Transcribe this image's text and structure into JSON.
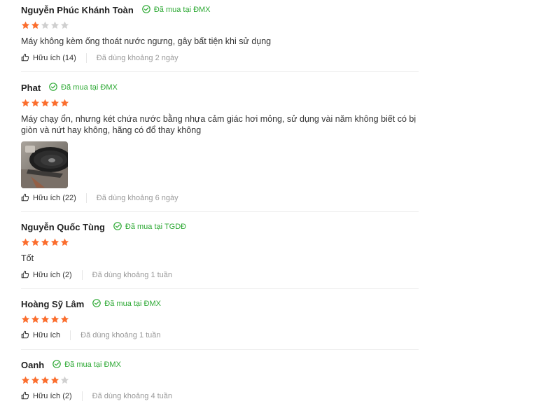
{
  "reviews": [
    {
      "name": "Nguyễn Phúc Khánh Toàn",
      "badge": "Đã mua tại ĐMX",
      "rating": 2,
      "comment": "Máy không kèm ống thoát nước ngưng, gây bất tiện khi sử dụng",
      "helpful": "Hữu ích (14)",
      "used": "Đã dùng khoảng 2 ngày"
    },
    {
      "name": "Phat",
      "badge": "Đã mua tại ĐMX",
      "rating": 5,
      "comment": "Máy chạy ổn, nhưng két chứa nước bằng nhựa cảm giác hơi mỏng, sử dụng vài năm không biết có bị giòn và nứt hay không, hãng có đổ thay không",
      "has_photo": true,
      "helpful": "Hữu ích (22)",
      "used": "Đã dùng khoảng 6 ngày"
    },
    {
      "name": "Nguyễn Quốc Tùng",
      "badge": "Đã mua tại TGDĐ",
      "rating": 5,
      "comment": "Tốt",
      "helpful": "Hữu ích (2)",
      "used": "Đã dùng khoảng 1 tuần"
    },
    {
      "name": "Hoàng Sỹ Lâm",
      "badge": "Đã mua tại ĐMX",
      "rating": 5,
      "comment": "",
      "helpful": "Hữu ích",
      "used": "Đã dùng khoảng 1 tuần"
    },
    {
      "name": "Oanh",
      "badge": "Đã mua tại ĐMX",
      "rating": 4,
      "comment": "",
      "helpful": "Hữu ích (2)",
      "used": "Đã dùng khoảng 4 tuần"
    }
  ],
  "max_rating": 5,
  "colors": {
    "star_filled": "#fb6e2e",
    "star_empty": "#d0d0d0",
    "badge_green": "#2ba832"
  },
  "icons": {
    "badge": "check-circle-icon",
    "helpful": "thumbs-up-icon",
    "star": "star-icon"
  }
}
